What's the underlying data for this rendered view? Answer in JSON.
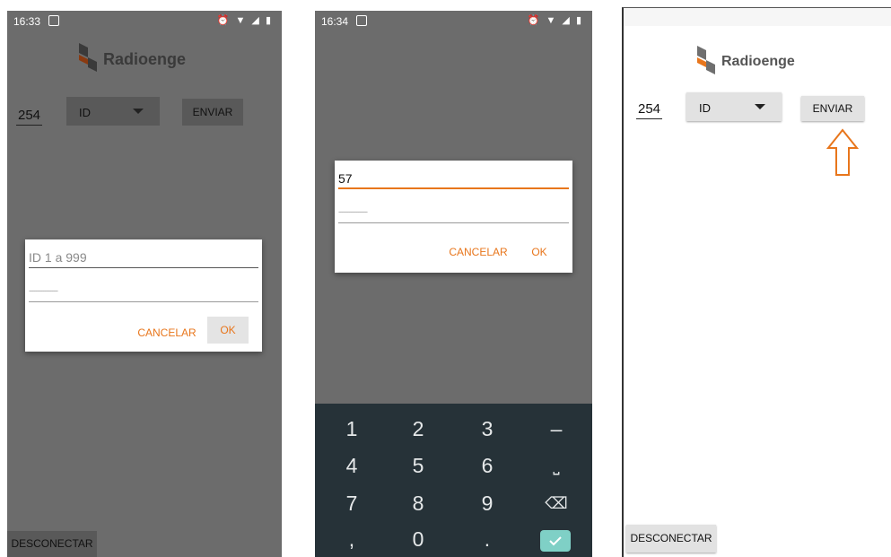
{
  "brand": {
    "name": "Radioenge"
  },
  "colors": {
    "accent": "#e8761c",
    "dim_bg": "#6c6c6c",
    "keyboard_bg": "#263238",
    "enter_key": "#7fd0c6"
  },
  "screen1": {
    "status_time": "16:33",
    "node_id": "254",
    "spinner_value": "ID",
    "send_label": "ENVIAR",
    "dialog": {
      "input_placeholder": "ID 1 a 999",
      "password_dots": "----------------",
      "cancel_label": "CANCELAR",
      "ok_label": "OK"
    },
    "disconnect_label": "DESCONECTAR"
  },
  "screen2": {
    "status_time": "16:34",
    "dialog": {
      "input_value": "57",
      "password_dots": "----------------",
      "cancel_label": "CANCELAR",
      "ok_label": "OK"
    },
    "keyboard": {
      "keys": [
        "1",
        "2",
        "3",
        "–",
        "4",
        "5",
        "6",
        "⎵",
        "7",
        "8",
        "9",
        "⌫",
        ",",
        "0",
        "."
      ],
      "enter_icon": "check-icon"
    }
  },
  "screen3": {
    "node_id": "254",
    "spinner_value": "ID",
    "send_label": "ENVIAR",
    "disconnect_label": "DESCONECTAR",
    "annotation": "arrow-up-icon"
  }
}
